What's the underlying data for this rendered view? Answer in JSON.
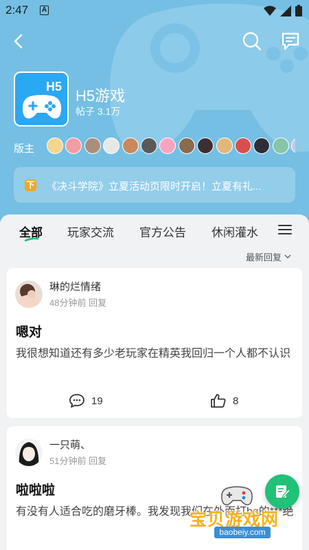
{
  "status_bar": {
    "time": "2:47",
    "a_badge": "A"
  },
  "forum": {
    "icon_text": "H5",
    "name": "H5游戏",
    "posts": "帖子 3.1万",
    "moderator_label": "版主",
    "moderator_avatar_colors": [
      "#f4d58d",
      "#f29ca3",
      "#a98f7b",
      "#e8e8e8",
      "#c9895d",
      "#5a5a5a",
      "#f6a5c0",
      "#8b6a4f",
      "#3b2f35",
      "#e3b77a",
      "#d94f4f",
      "#2e2e3a",
      "#86c5a7",
      "#c7c7ef",
      "#f0efe8",
      "#4b3a30",
      "#b4a6a6"
    ]
  },
  "notice": {
    "icon": "下",
    "text": "《决斗学院》立夏活动页限时开启！立夏有礼..."
  },
  "tabs": [
    {
      "label": "全部",
      "active": true
    },
    {
      "label": "玩家交流"
    },
    {
      "label": "官方公告"
    },
    {
      "label": "休闲灌水"
    }
  ],
  "sort_label": "最新回复",
  "posts": [
    {
      "author": "琳的烂情绪",
      "meta": "48分钟前 回复",
      "title": "嗯对",
      "body": "我很想知道还有多少老玩家在精英我回归一个人都不认识",
      "comments": "19",
      "likes": "8"
    },
    {
      "author": "一只萌、",
      "meta": "51分钟前 回复",
      "title": "啦啦啦",
      "body": "有没有人适合吃的磨牙棒。我发现我们在外面打hq的***绝"
    }
  ],
  "watermark": {
    "text": "宝贝游戏网",
    "url": "baobeiy.com"
  },
  "icons": [
    "back-icon",
    "search-icon",
    "message-icon",
    "gamepad-icon",
    "wifi-icon",
    "signal-icon",
    "battery-icon",
    "notice-icon",
    "menu-icon",
    "chevron-down-icon",
    "comment-icon",
    "like-icon",
    "edit-icon"
  ],
  "colors": {
    "header": "#74bfe3",
    "accent_green": "#21c177",
    "app_icon": "#2ca7f2",
    "notice_icon": "#f5a623"
  }
}
